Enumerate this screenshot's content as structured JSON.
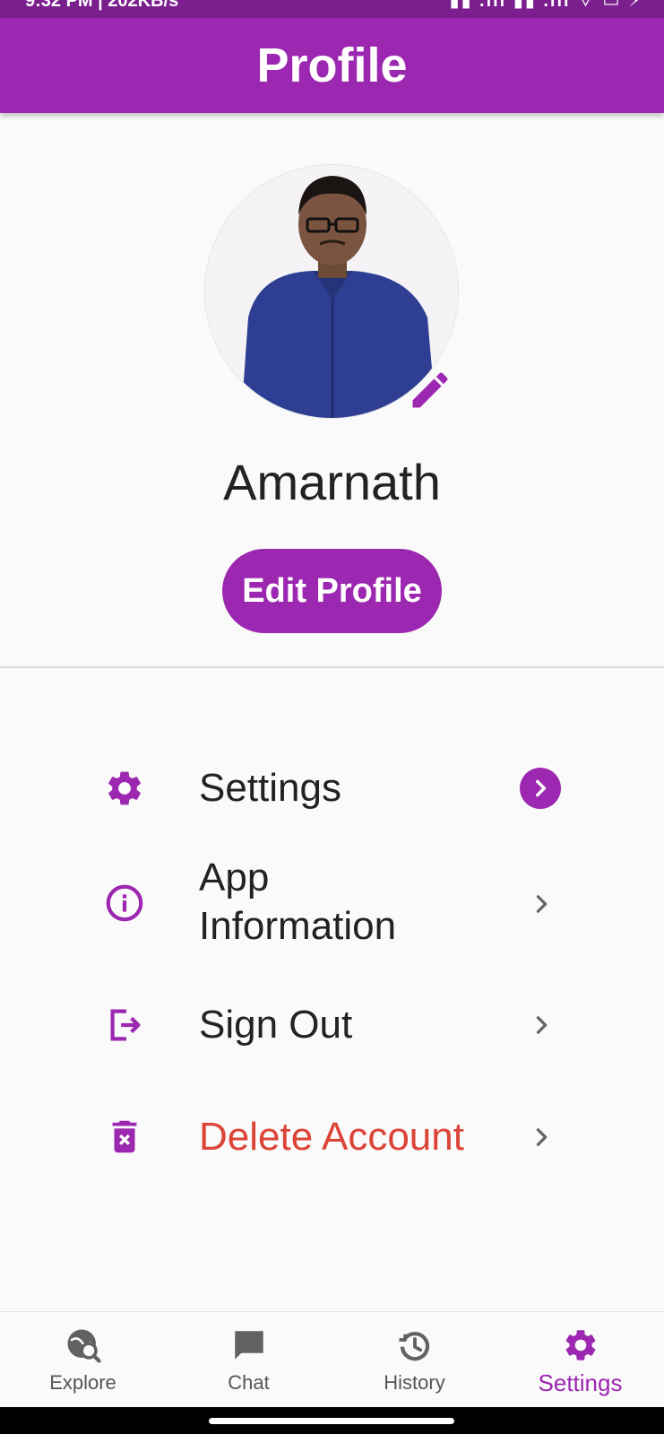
{
  "status_bar": {
    "left_text": "9:32 PM | 202KB/s",
    "right_text": "▮▮ .ıll ▮▮ .ıll ⌔ ▭ ⚡"
  },
  "app_bar": {
    "title": "Profile"
  },
  "profile": {
    "name": "Amarnath",
    "edit_button": "Edit Profile"
  },
  "menu": {
    "items": [
      {
        "label": "Settings",
        "icon": "gear-icon"
      },
      {
        "label_line1": "App",
        "label_line2": "Information",
        "icon": "info-icon"
      },
      {
        "label": "Sign Out",
        "icon": "logout-icon"
      },
      {
        "label": "Delete Account",
        "icon": "delete-icon",
        "color": "#dc4437"
      }
    ]
  },
  "bottom_nav": {
    "items": [
      {
        "label": "Explore",
        "icon": "explore-icon"
      },
      {
        "label": "Chat",
        "icon": "chat-icon"
      },
      {
        "label": "History",
        "icon": "history-icon"
      },
      {
        "label": "Settings",
        "icon": "gear-icon",
        "active": true
      }
    ]
  },
  "colors": {
    "primary": "#9c27b0",
    "status_bar": "#7b1f8f",
    "danger": "#dc4437",
    "icon_grey": "#616161"
  }
}
